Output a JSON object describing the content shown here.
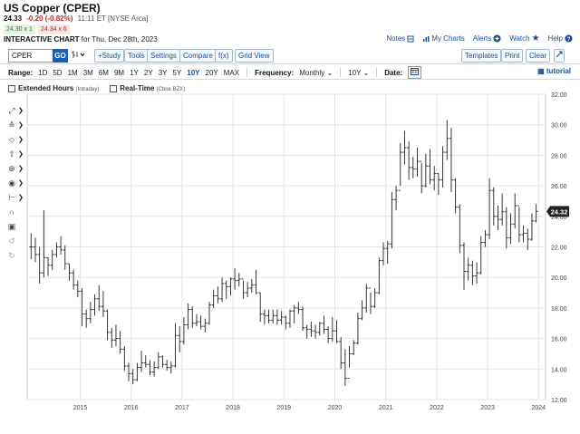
{
  "header": {
    "title": "US Copper (CPER)",
    "price": "24.33",
    "change": "-0.20 (-0.82%)",
    "time": "11:11 ET [NYSE Arca]",
    "bid": "24.30 x 1",
    "ask": "24.34 x 6",
    "chart_title": "INTERACTIVE CHART",
    "chart_date": "for Thu, Dec 28th, 2023"
  },
  "toplinks": {
    "notes": "Notes",
    "my_charts": "My Charts",
    "alerts": "Alerts",
    "watch": "Watch",
    "help": "Help"
  },
  "toolbar": {
    "symbol": "CPER",
    "go": "GO",
    "study": "+Study",
    "tools": "Tools",
    "settings": "Settings",
    "compare": "Compare",
    "fx": "f(x)",
    "grid_view": "Grid View",
    "templates": "Templates",
    "print": "Print",
    "clear": "Clear"
  },
  "rangebar": {
    "range_label": "Range:",
    "ranges": [
      "1D",
      "5D",
      "1M",
      "3M",
      "6M",
      "9M",
      "1Y",
      "2Y",
      "3Y",
      "5Y",
      "10Y",
      "20Y",
      "MAX"
    ],
    "active_range": "10Y",
    "frequency_label": "Frequency:",
    "frequency_value": "Monthly",
    "period_value": "10Y",
    "date_label": "Date:",
    "tutorial": "tutorial"
  },
  "checks": {
    "extended": "Extended Hours",
    "extended_sub": "(Intraday)",
    "realtime": "Real-Time",
    "realtime_sub": "(Cboe BZX)"
  },
  "colors": {
    "accent": "#1d5fa8",
    "down": "#c0262b",
    "up": "#1c7a2a",
    "bars": "#222222",
    "price_tag": "#222222"
  },
  "chart_data": {
    "type": "ohlc",
    "frequency": "monthly",
    "ylim": [
      12,
      32
    ],
    "yticks": [
      "12.00",
      "14.00",
      "16.00",
      "18.00",
      "20.00",
      "22.00",
      "24.00",
      "26.00",
      "28.00",
      "30.00",
      "32.00"
    ],
    "xticks": [
      "2015",
      "2016",
      "2017",
      "2018",
      "2019",
      "2020",
      "2021",
      "2022",
      "2023",
      "2024"
    ],
    "start": "2014-01",
    "last_price_label": "24.32",
    "bars": [
      [
        22.9,
        21.2,
        22.0
      ],
      [
        22.6,
        21.0,
        21.5
      ],
      [
        22.0,
        19.6,
        20.3
      ],
      [
        24.4,
        20.0,
        21.3
      ],
      [
        21.3,
        20.1,
        20.8
      ],
      [
        21.8,
        20.5,
        21.5
      ],
      [
        22.3,
        21.3,
        22.0
      ],
      [
        22.7,
        21.5,
        21.8
      ],
      [
        22.1,
        20.5,
        20.9
      ],
      [
        20.9,
        19.8,
        20.3
      ],
      [
        20.5,
        19.2,
        19.5
      ],
      [
        19.8,
        18.7,
        19.1
      ],
      [
        19.3,
        16.8,
        17.6
      ],
      [
        17.9,
        16.7,
        17.3
      ],
      [
        18.4,
        17.0,
        17.9
      ],
      [
        18.9,
        17.5,
        18.6
      ],
      [
        19.5,
        17.8,
        18.1
      ],
      [
        19.1,
        17.4,
        17.8
      ],
      [
        17.9,
        15.9,
        16.4
      ],
      [
        16.7,
        15.4,
        15.9
      ],
      [
        16.9,
        15.5,
        16.0
      ],
      [
        16.5,
        15.0,
        15.3
      ],
      [
        15.5,
        13.9,
        14.2
      ],
      [
        14.4,
        13.2,
        13.7
      ],
      [
        14.0,
        13.0,
        13.3
      ],
      [
        14.4,
        13.2,
        14.1
      ],
      [
        15.2,
        13.8,
        14.4
      ],
      [
        14.9,
        14.1,
        14.3
      ],
      [
        14.6,
        13.6,
        13.8
      ],
      [
        14.5,
        13.5,
        14.1
      ],
      [
        15.1,
        14.0,
        14.8
      ],
      [
        14.9,
        14.1,
        14.3
      ],
      [
        14.6,
        13.9,
        14.1
      ],
      [
        14.5,
        13.7,
        14.2
      ],
      [
        17.0,
        14.1,
        16.2
      ],
      [
        16.8,
        15.1,
        15.8
      ],
      [
        17.4,
        15.6,
        16.9
      ],
      [
        18.3,
        16.6,
        17.9
      ],
      [
        18.1,
        16.7,
        17.0
      ],
      [
        17.6,
        16.8,
        17.1
      ],
      [
        17.5,
        16.6,
        16.8
      ],
      [
        17.3,
        16.4,
        17.0
      ],
      [
        18.4,
        16.9,
        18.2
      ],
      [
        19.2,
        18.0,
        18.8
      ],
      [
        19.4,
        18.3,
        18.6
      ],
      [
        20.0,
        18.4,
        19.6
      ],
      [
        19.8,
        18.6,
        19.4
      ],
      [
        20.0,
        18.8,
        19.9
      ],
      [
        20.6,
        19.2,
        19.8
      ],
      [
        20.3,
        19.4,
        19.9
      ],
      [
        19.8,
        18.6,
        19.0
      ],
      [
        19.7,
        18.7,
        19.3
      ],
      [
        19.9,
        19.0,
        19.5
      ],
      [
        20.5,
        18.9,
        19.0
      ],
      [
        19.0,
        17.1,
        17.6
      ],
      [
        17.9,
        16.9,
        17.5
      ],
      [
        17.9,
        17.0,
        17.2
      ],
      [
        17.9,
        17.0,
        17.5
      ],
      [
        17.9,
        16.9,
        17.2
      ],
      [
        17.8,
        16.9,
        17.4
      ],
      [
        17.5,
        16.6,
        17.0
      ],
      [
        17.9,
        16.7,
        17.8
      ],
      [
        18.2,
        17.0,
        18.0
      ],
      [
        18.4,
        17.6,
        17.9
      ],
      [
        18.1,
        16.5,
        16.7
      ],
      [
        16.9,
        16.0,
        16.6
      ],
      [
        17.1,
        16.1,
        16.5
      ],
      [
        16.9,
        16.0,
        16.4
      ],
      [
        17.1,
        16.2,
        17.0
      ],
      [
        17.5,
        16.3,
        16.6
      ],
      [
        16.8,
        15.7,
        16.0
      ],
      [
        17.4,
        15.8,
        16.5
      ],
      [
        17.2,
        15.7,
        15.8
      ],
      [
        16.1,
        14.0,
        14.4
      ],
      [
        15.3,
        12.9,
        13.4
      ],
      [
        15.5,
        14.1,
        15.0
      ],
      [
        15.9,
        14.9,
        15.7
      ],
      [
        17.7,
        15.6,
        17.3
      ],
      [
        18.5,
        17.2,
        18.0
      ],
      [
        19.6,
        17.7,
        19.3
      ],
      [
        19.0,
        17.6,
        18.1
      ],
      [
        19.3,
        18.0,
        19.0
      ],
      [
        21.3,
        18.9,
        21.1
      ],
      [
        22.3,
        20.8,
        21.9
      ],
      [
        22.4,
        20.9,
        22.2
      ],
      [
        25.6,
        21.9,
        25.1
      ],
      [
        26.0,
        24.4,
        25.7
      ],
      [
        28.8,
        26.0,
        28.2
      ],
      [
        29.6,
        27.4,
        28.5
      ],
      [
        28.9,
        26.4,
        27.2
      ],
      [
        27.9,
        26.5,
        27.1
      ],
      [
        28.5,
        26.6,
        27.6
      ],
      [
        27.5,
        25.5,
        26.0
      ],
      [
        28.1,
        25.9,
        27.3
      ],
      [
        28.4,
        26.1,
        26.4
      ],
      [
        27.3,
        25.7,
        26.8
      ],
      [
        26.8,
        25.4,
        26.4
      ],
      [
        28.6,
        25.9,
        28.2
      ],
      [
        30.3,
        27.7,
        29.1
      ],
      [
        29.8,
        25.6,
        26.4
      ],
      [
        26.5,
        24.2,
        24.6
      ],
      [
        24.8,
        21.6,
        22.1
      ],
      [
        22.3,
        19.2,
        20.4
      ],
      [
        21.3,
        19.8,
        20.8
      ],
      [
        21.1,
        19.5,
        20.1
      ],
      [
        21.0,
        19.6,
        20.3
      ],
      [
        22.7,
        20.2,
        22.3
      ],
      [
        23.1,
        22.0,
        22.8
      ],
      [
        26.5,
        22.5,
        25.7
      ],
      [
        25.9,
        23.4,
        24.0
      ],
      [
        24.7,
        23.1,
        23.8
      ],
      [
        25.5,
        23.4,
        24.3
      ],
      [
        24.6,
        21.9,
        22.6
      ],
      [
        24.2,
        22.2,
        23.5
      ],
      [
        25.5,
        23.2,
        24.7
      ],
      [
        24.6,
        22.3,
        22.8
      ],
      [
        23.4,
        22.3,
        22.9
      ],
      [
        23.2,
        21.8,
        22.5
      ],
      [
        24.2,
        22.4,
        23.7
      ],
      [
        24.8,
        23.6,
        24.33
      ]
    ]
  }
}
